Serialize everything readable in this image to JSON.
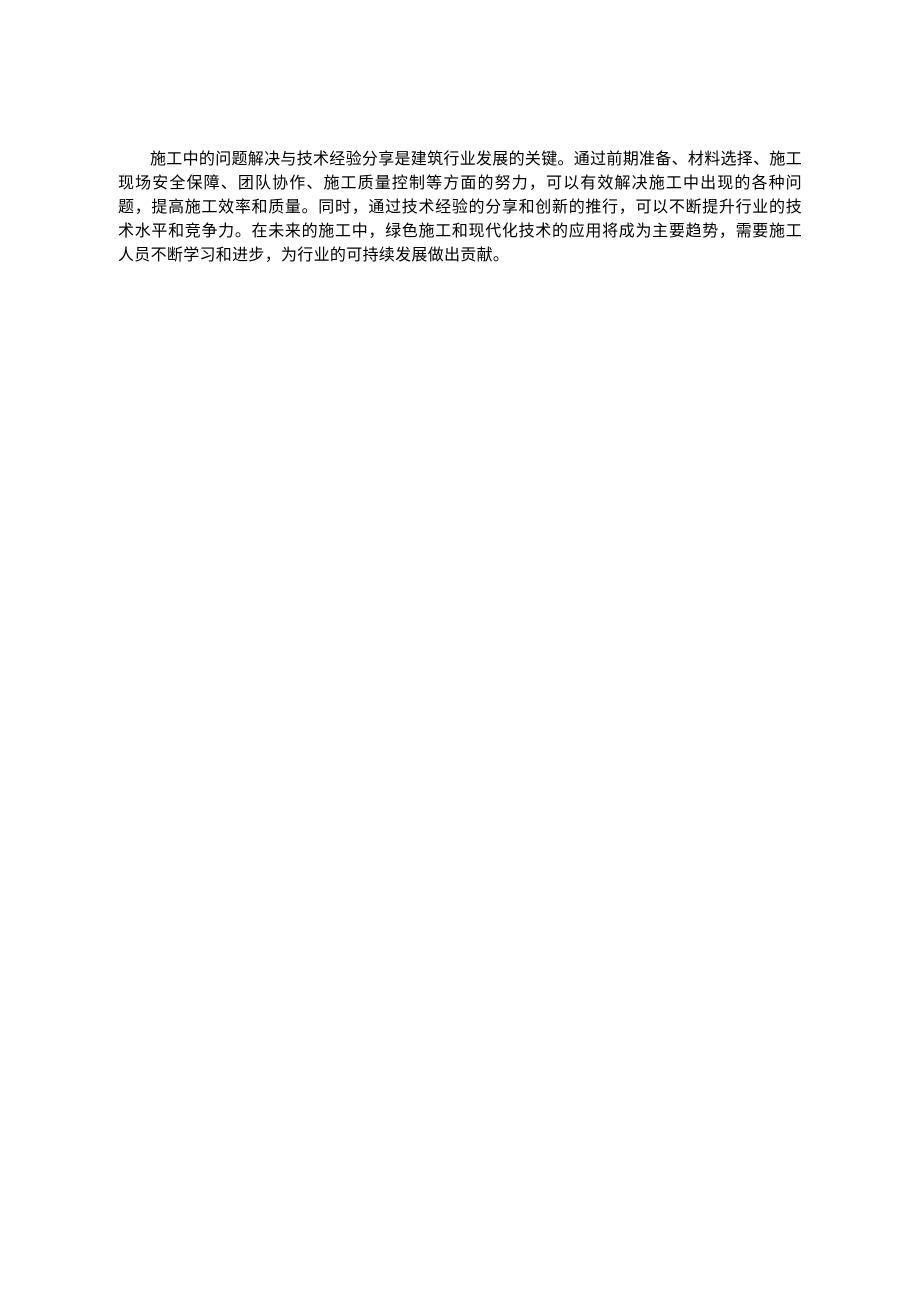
{
  "document": {
    "paragraph": "施工中的问题解决与技术经验分享是建筑行业发展的关键。通过前期准备、材料选择、施工现场安全保障、团队协作、施工质量控制等方面的努力，可以有效解决施工中出现的各种问题，提高施工效率和质量。同时，通过技术经验的分享和创新的推行，可以不断提升行业的技术水平和竞争力。在未来的施工中，绿色施工和现代化技术的应用将成为主要趋势，需要施工人员不断学习和进步，为行业的可持续发展做出贡献。"
  }
}
